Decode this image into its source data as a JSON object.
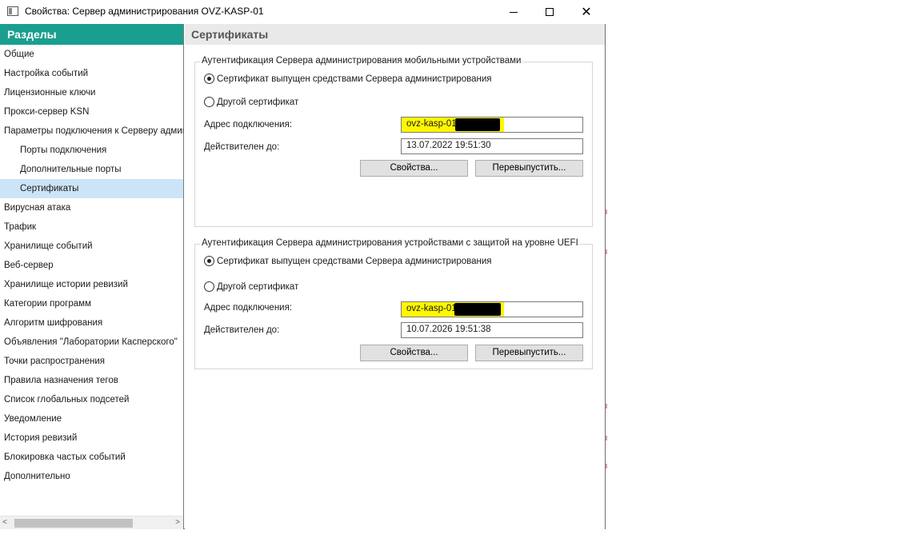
{
  "window": {
    "title": "Свойства: Сервер администрирования OVZ-KASP-01",
    "minimize_symbol": "",
    "close_symbol": "✕"
  },
  "sidebar": {
    "header": "Разделы",
    "items": [
      {
        "label": "Общие"
      },
      {
        "label": "Настройка событий"
      },
      {
        "label": "Лицензионные ключи"
      },
      {
        "label": "Прокси-сервер KSN"
      },
      {
        "label": "Параметры подключения к Серверу админи"
      },
      {
        "label": "Порты подключения"
      },
      {
        "label": "Дополнительные порты"
      },
      {
        "label": "Сертификаты"
      },
      {
        "label": "Вирусная атака"
      },
      {
        "label": "Трафик"
      },
      {
        "label": "Хранилище событий"
      },
      {
        "label": "Веб-сервер"
      },
      {
        "label": "Хранилище истории ревизий"
      },
      {
        "label": "Категории программ"
      },
      {
        "label": "Алгоритм шифрования"
      },
      {
        "label": "Объявления \"Лаборатории Касперского\""
      },
      {
        "label": "Точки распространения"
      },
      {
        "label": "Правила назначения тегов"
      },
      {
        "label": "Список глобальных подсетей"
      },
      {
        "label": "Уведомление"
      },
      {
        "label": "История ревизий"
      },
      {
        "label": "Блокировка частых событий"
      },
      {
        "label": "Дополнительно"
      }
    ],
    "scroll_left": "<",
    "scroll_right": ">"
  },
  "content": {
    "title": "Сертификаты",
    "mobile_group": {
      "legend": "Аутентификация Сервера администрирования мобильными устройствами",
      "radio_server": "Сертификат выпущен средствами Сервера администрирования",
      "radio_other": "Другой сертификат",
      "address_label": "Адрес подключения:",
      "address_value": "ovz-kasp-01",
      "valid_label": "Действителен до:",
      "valid_value": "13.07.2022 19:51:30",
      "properties_button": "Свойства...",
      "reissue_button": "Перевыпустить..."
    },
    "uefi_group": {
      "legend": "Аутентификация Сервера администрирования устройствами с защитой на уровне UEFI",
      "radio_server": "Сертификат выпущен средствами Сервера администрирования",
      "radio_other": "Другой сертификат",
      "address_label": "Адрес подключения:",
      "address_value": "ovz-kasp-01",
      "valid_label": "Действителен до:",
      "valid_value": "10.07.2026 19:51:38",
      "properties_button": "Свойства...",
      "reissue_button": "Перевыпустить..."
    }
  },
  "colors": {
    "sidebar_header": "#1a9e8f",
    "selected_item": "#cce4f7",
    "highlight": "#fff700"
  },
  "selected_item": "Сертификаты"
}
